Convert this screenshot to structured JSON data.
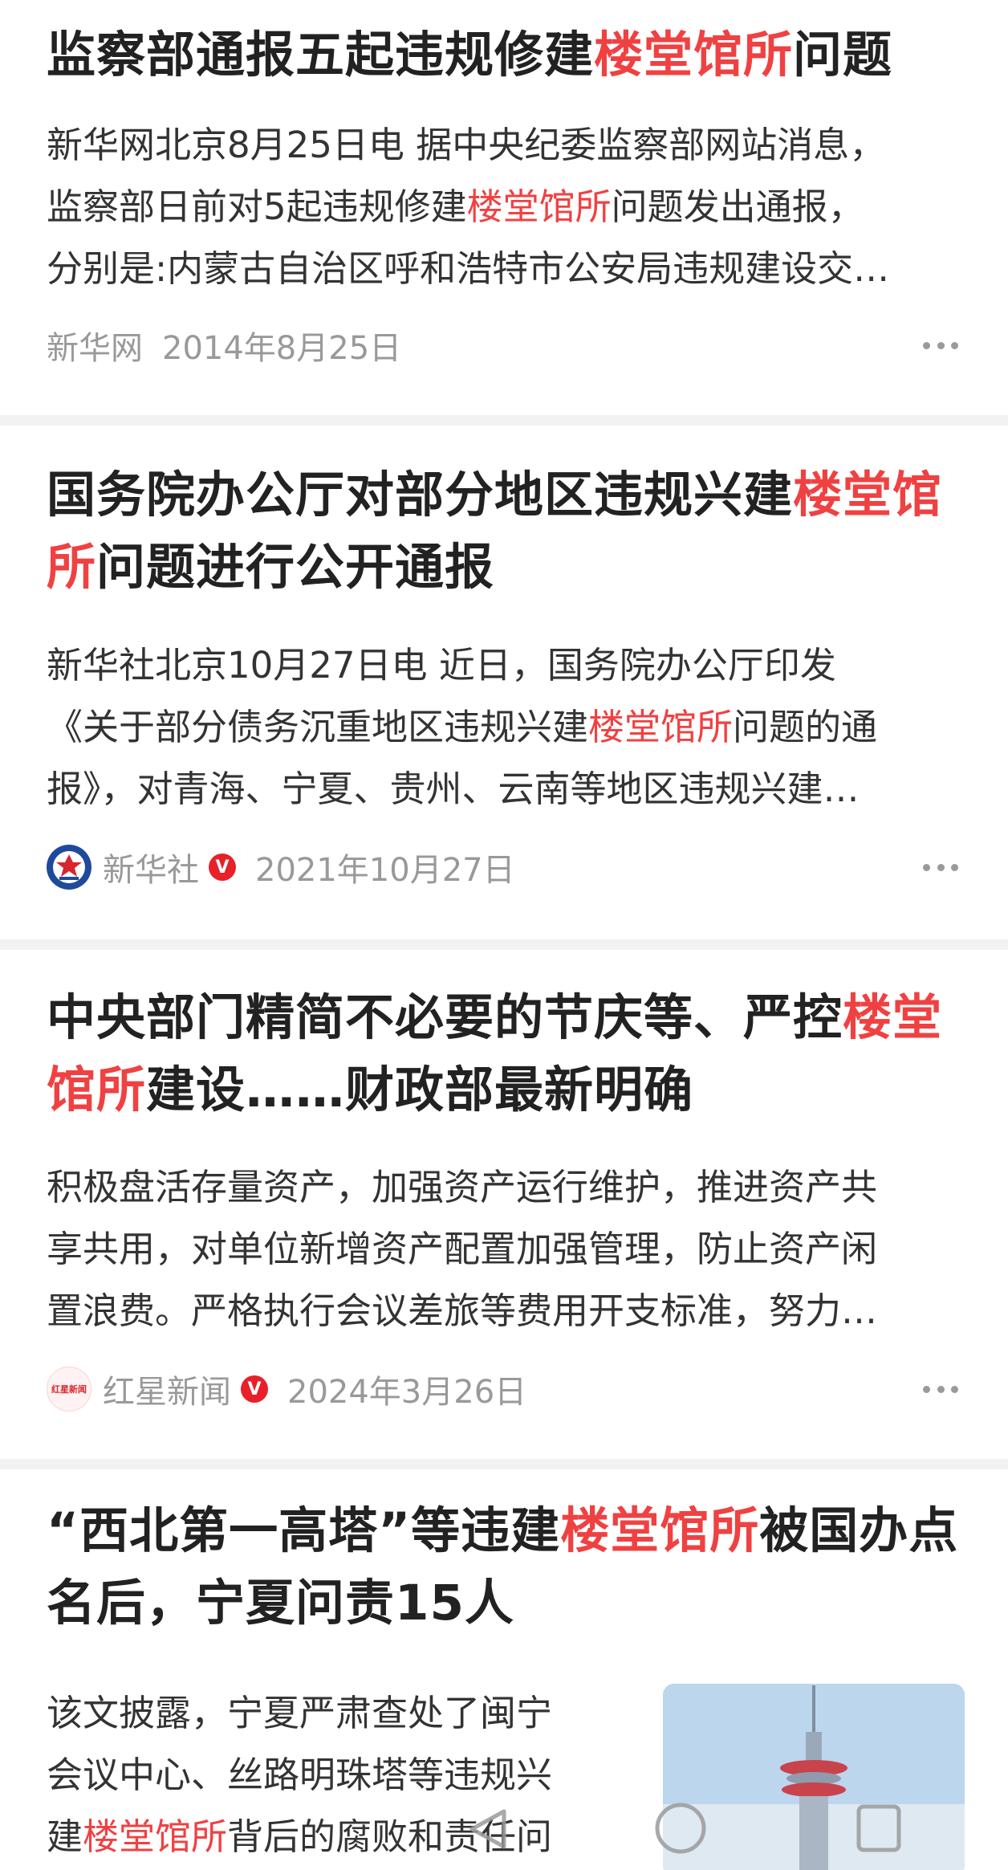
{
  "articles": [
    {
      "title_lines": [
        [
          {
            "t": "监察部通报五起违规修建",
            "h": false
          },
          {
            "t": "楼堂馆所",
            "h": true
          },
          {
            "t": "问题",
            "h": false
          }
        ]
      ],
      "abstract_lines": [
        [
          {
            "t": "新华网北京8月25日电 据中央纪委监察部网站消息，",
            "h": false
          }
        ],
        [
          {
            "t": "监察部日前对5起违规修建",
            "h": false
          },
          {
            "t": "楼堂馆所",
            "h": true
          },
          {
            "t": "问题发出通报，",
            "h": false
          }
        ],
        [
          {
            "t": "分别是:内蒙古自治区呼和浩特市公安局违规建设交…",
            "h": false
          }
        ]
      ],
      "source": "新华网",
      "verified": false,
      "date": "2014年8月25日"
    },
    {
      "title_lines": [
        [
          {
            "t": "国务院办公厅对部分地区违规兴建",
            "h": false
          },
          {
            "t": "楼堂馆",
            "h": true
          }
        ],
        [
          {
            "t": "所",
            "h": true
          },
          {
            "t": "问题进行公开通报",
            "h": false
          }
        ]
      ],
      "abstract_lines": [
        [
          {
            "t": "新华社北京10月27日电 近日，国务院办公厅印发",
            "h": false
          }
        ],
        [
          {
            "t": "《关于部分债务沉重地区违规兴建",
            "h": false
          },
          {
            "t": "楼堂馆所",
            "h": true
          },
          {
            "t": "问题的通",
            "h": false
          }
        ],
        [
          {
            "t": "报》，对青海、宁夏、贵州、云南等地区违规兴建…",
            "h": false
          }
        ]
      ],
      "source": "新华社",
      "verified": true,
      "date": "2021年10月27日"
    },
    {
      "title_lines": [
        [
          {
            "t": "中央部门精简不必要的节庆等、严控",
            "h": false
          },
          {
            "t": "楼堂",
            "h": true
          }
        ],
        [
          {
            "t": "馆所",
            "h": true
          },
          {
            "t": "建设……财政部最新明确",
            "h": false
          }
        ]
      ],
      "abstract_lines": [
        [
          {
            "t": "积极盘活存量资产，加强资产运行维护，推进资产共",
            "h": false
          }
        ],
        [
          {
            "t": "享共用，对单位新增资产配置加强管理，防止资产闲",
            "h": false
          }
        ],
        [
          {
            "t": "置浪费。严格执行会议差旅等费用开支标准，努力…",
            "h": false
          }
        ]
      ],
      "source": "红星新闻",
      "source_logo_text": "红星新闻",
      "verified": true,
      "date": "2024年3月26日"
    },
    {
      "title_lines": [
        [
          {
            "t": "“西北第一高塔”等违建",
            "h": false
          },
          {
            "t": "楼堂馆所",
            "h": true
          },
          {
            "t": "被国办点",
            "h": false
          }
        ],
        [
          {
            "t": "名后，宁夏问责15人",
            "h": false
          }
        ]
      ],
      "abstract_lines": [
        [
          {
            "t": "该文披露，宁夏严肃查处了闽宁",
            "h": false
          }
        ],
        [
          {
            "t": "会议中心、丝路明珠塔等违规兴",
            "h": false
          }
        ],
        [
          {
            "t": "建",
            "h": false
          },
          {
            "t": "楼堂馆所",
            "h": true
          },
          {
            "t": "背后的腐败和责任问",
            "h": false
          }
        ]
      ]
    }
  ],
  "verified_badge": "V",
  "colors": {
    "highlight": "#f04142",
    "meta": "#999999",
    "separator": "#f2f2f2"
  },
  "icons": {
    "more": "more-dots-icon",
    "nav_back": "back-triangle-icon",
    "nav_home": "home-circle-icon",
    "nav_recent": "recent-square-icon"
  }
}
